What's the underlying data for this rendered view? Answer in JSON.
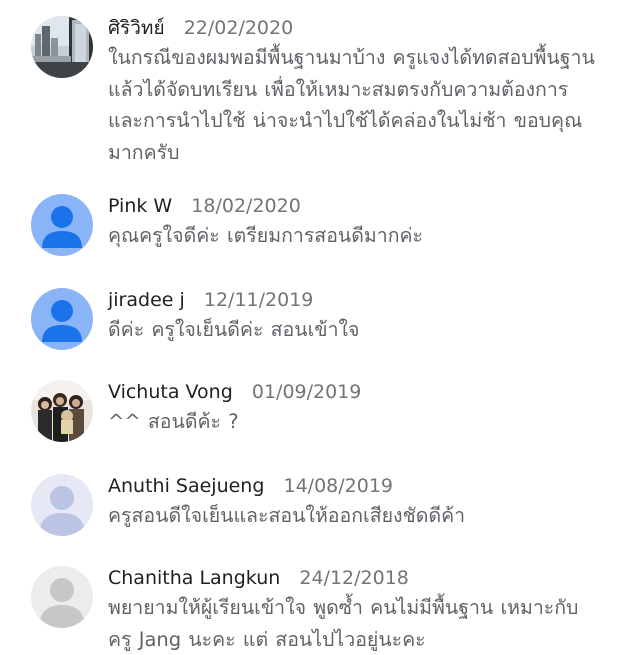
{
  "reviews": [
    {
      "name": "ศิริวิทย์",
      "date": "22/02/2020",
      "lines": [
        "ในกรณีของผมพอมีพื้นฐานมาบ้าง ครูแจงได้ทดสอบพื้นฐาน",
        "แล้วได้จัดบทเรียน เพื่อให้เหมาะสมตรงกับความต้องการ",
        "และการนำไปใช้  น่าจะนำไปใช้ได้คล่องในไม่ช้า ขอบคุณ",
        "มากครับ"
      ],
      "avatar": "photo-building"
    },
    {
      "name": "Pink W",
      "date": "18/02/2020",
      "lines": [
        "คุณครูใจดีค่ะ เตรียมการสอนดีมากค่ะ"
      ],
      "avatar": "default-blue"
    },
    {
      "name": "jiradee j",
      "date": "12/11/2019",
      "lines": [
        "ดีค่ะ ครูใจเย็นดีค่ะ สอนเข้าใจ"
      ],
      "avatar": "default-blue"
    },
    {
      "name": "Vichuta Vong",
      "date": "01/09/2019",
      "lines": [
        "^^  สอนดีค้ะ   ?"
      ],
      "avatar": "photo-group"
    },
    {
      "name": "Anuthi Saejueng",
      "date": "14/08/2019",
      "lines": [
        "ครูสอนดีใจเย็นและสอนให้ออกเสียงชัดดีค้า"
      ],
      "avatar": "default-gray"
    },
    {
      "name": "Chanitha Langkun",
      "date": "24/12/2018",
      "lines": [
        "พยายามให้ผู้เรียนเข้าใจ  พูดซ้ำ  คนไม่มีพื้นฐาน เหมาะกับ",
        "ครู Jang  นะคะ  แต่ สอนไปไวอยู่นะคะ"
      ],
      "avatar": "default-gray"
    }
  ]
}
